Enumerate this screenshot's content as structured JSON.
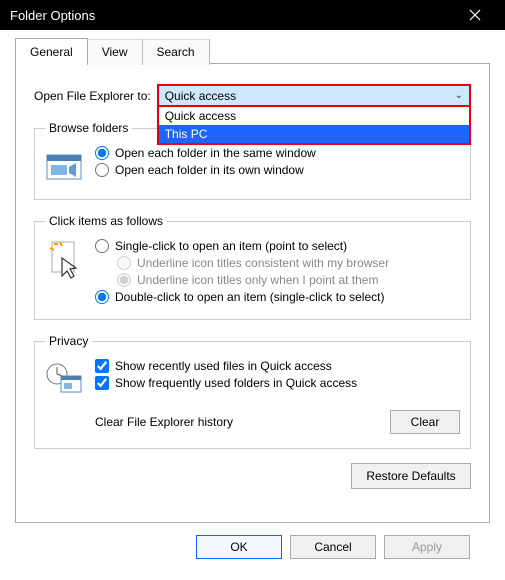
{
  "window": {
    "title": "Folder Options"
  },
  "tabs": {
    "general": "General",
    "view": "View",
    "search": "Search"
  },
  "open_to": {
    "label": "Open File Explorer to:",
    "selected": "Quick access",
    "options": [
      "Quick access",
      "This PC"
    ]
  },
  "browse": {
    "legend": "Browse folders",
    "same": "Open each folder in the same window",
    "own": "Open each folder in its own window"
  },
  "click": {
    "legend": "Click items as follows",
    "single": "Single-click to open an item (point to select)",
    "u_browser": "Underline icon titles consistent with my browser",
    "u_point": "Underline icon titles only when I point at them",
    "double": "Double-click to open an item (single-click to select)"
  },
  "privacy": {
    "legend": "Privacy",
    "recent_files": "Show recently used files in Quick access",
    "freq_folders": "Show frequently used folders in Quick access",
    "clear_label": "Clear File Explorer history",
    "clear_btn": "Clear"
  },
  "restore": "Restore Defaults",
  "buttons": {
    "ok": "OK",
    "cancel": "Cancel",
    "apply": "Apply"
  }
}
